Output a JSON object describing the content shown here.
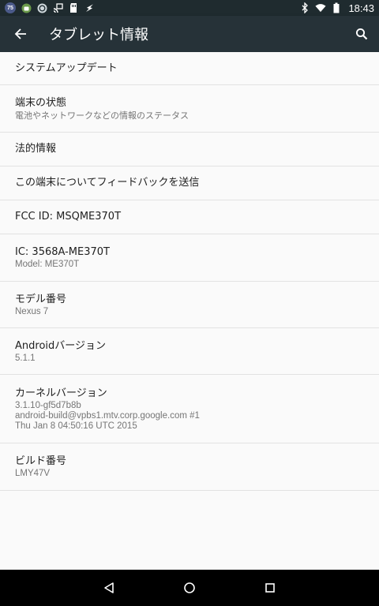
{
  "status_bar": {
    "notification_badge": "75",
    "time": "18:43",
    "left_icons": [
      "badge-icon",
      "android-icon",
      "sync-icon",
      "cast-icon",
      "sd-card-icon",
      "flash-icon"
    ],
    "right_icons": [
      "bluetooth-icon",
      "wifi-icon",
      "battery-icon"
    ]
  },
  "app_bar": {
    "title": "タブレット情報"
  },
  "items": [
    {
      "title": "システムアップデート"
    },
    {
      "title": "端末の状態",
      "subtitle": "電池やネットワークなどの情報のステータス"
    },
    {
      "title": "法的情報"
    },
    {
      "title": "この端末についてフィードバックを送信"
    },
    {
      "title": "FCC ID: MSQME370T"
    },
    {
      "title": "IC: 3568A-ME370T",
      "subtitle": "Model: ME370T"
    },
    {
      "title": "モデル番号",
      "subtitle": "Nexus 7"
    },
    {
      "title": "Androidバージョン",
      "subtitle": "5.1.1"
    },
    {
      "title": "カーネルバージョン",
      "subtitle_lines": [
        "3.1.10-gf5d7b8b",
        "android-build@vpbs1.mtv.corp.google.com #1",
        "Thu Jan 8 04:50:16 UTC 2015"
      ]
    },
    {
      "title": "ビルド番号",
      "subtitle": "LMY47V"
    }
  ],
  "nav_bar": {
    "buttons": [
      "back-icon",
      "home-icon",
      "recents-icon"
    ]
  }
}
